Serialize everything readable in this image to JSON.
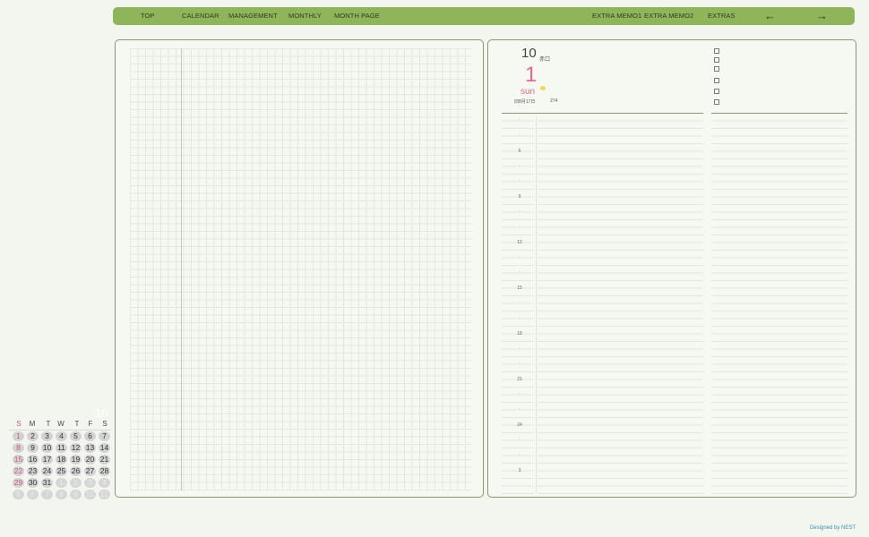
{
  "nav": {
    "items": [
      "TOP",
      "CALENDAR",
      "MANAGEMENT",
      "MONTHLY",
      "MONTH PAGE",
      "EXTRA MEMO1",
      "EXTRA MEMO2",
      "EXTRAS"
    ],
    "prev_arrow": "←",
    "next_arrow": "→"
  },
  "day": {
    "month": "10",
    "rokuyo": "赤口",
    "date": "1",
    "weekday": "sun",
    "lunar": "旧8月17日",
    "day_of_year": "274"
  },
  "hours": [
    "·",
    "·",
    "6",
    "·",
    "·",
    "9",
    "·",
    "·",
    "12",
    "·",
    "·",
    "15",
    "·",
    "·",
    "18",
    "·",
    "·",
    "21",
    "·",
    "·",
    "24",
    "·",
    "·",
    "3"
  ],
  "mini_calendar": {
    "month": "10",
    "weekdays": [
      "S",
      "M",
      "T",
      "W",
      "T",
      "F",
      "S"
    ],
    "weeks": [
      [
        "1",
        "2",
        "3",
        "4",
        "5",
        "6",
        "7"
      ],
      [
        "8",
        "9",
        "10",
        "11",
        "12",
        "13",
        "14"
      ],
      [
        "15",
        "16",
        "17",
        "18",
        "19",
        "20",
        "21"
      ],
      [
        "22",
        "23",
        "24",
        "25",
        "26",
        "27",
        "28"
      ],
      [
        "29",
        "30",
        "31",
        "1",
        "2",
        "3",
        "4"
      ],
      [
        "5",
        "6",
        "7",
        "8",
        "9",
        "10",
        "11"
      ]
    ]
  },
  "colors": {
    "accent_green": "#8fb55a",
    "sunday_pink": "#d05a84",
    "date_pink": "#e06b8f",
    "credit_blue": "#3a8fb0"
  },
  "credit": "Designed by NEST"
}
